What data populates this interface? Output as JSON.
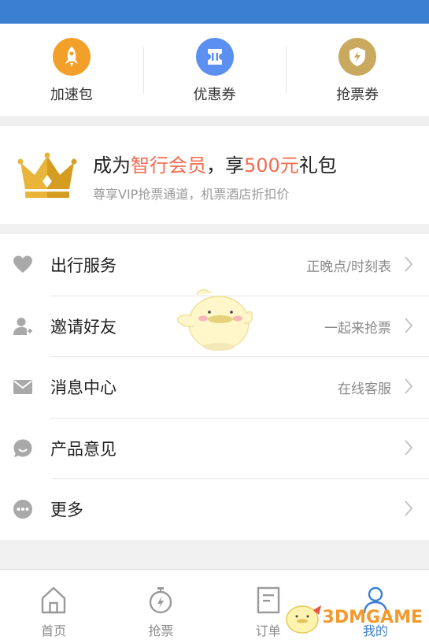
{
  "quick_actions": [
    {
      "label": "加速包",
      "icon": "rocket-icon",
      "color": "#f3a02b"
    },
    {
      "label": "优惠券",
      "icon": "ticket-icon",
      "color": "#5b8ff0"
    },
    {
      "label": "抢票券",
      "icon": "shield-icon",
      "color": "#c9a95d"
    }
  ],
  "vip": {
    "title_pre": "成为",
    "title_hl1": "智行会员",
    "title_mid": "，享",
    "title_hl2": "500元",
    "title_post": "礼包",
    "subtitle": "尊享VIP抢票通道，机票酒店折扣价"
  },
  "menu": [
    {
      "label": "出行服务",
      "value": "正晚点/时刻表",
      "icon": "heart-icon"
    },
    {
      "label": "邀请好友",
      "value": "一起来抢票",
      "icon": "user-add-icon"
    },
    {
      "label": "消息中心",
      "value": "在线客服",
      "icon": "mail-icon"
    },
    {
      "label": "产品意见",
      "value": "",
      "icon": "feedback-icon"
    },
    {
      "label": "更多",
      "value": "",
      "icon": "more-icon"
    }
  ],
  "tabs": [
    {
      "label": "首页",
      "icon": "home-icon",
      "active": false
    },
    {
      "label": "抢票",
      "icon": "stopwatch-icon",
      "active": false
    },
    {
      "label": "订单",
      "icon": "order-icon",
      "active": false
    },
    {
      "label": "我的",
      "icon": "profile-icon",
      "active": true
    }
  ],
  "colors": {
    "accent": "#3b7fd0",
    "highlight": "#f46a4f",
    "gold": "#e8b53a"
  },
  "watermark": "3DMGAME"
}
